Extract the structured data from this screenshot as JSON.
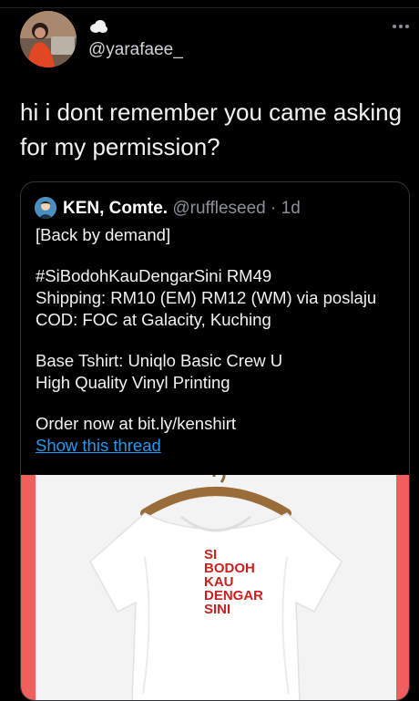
{
  "tweet": {
    "handle": "@yarafaee_",
    "text_line1": "hi i dont remember you came asking",
    "text_line2": "for my permission?"
  },
  "quote": {
    "name": "KEN, Comte.",
    "handle": "@ruffleseed",
    "separator": " · ",
    "time": "1d",
    "lines": [
      "[Back by demand]",
      "",
      "#SiBodohKauDengarSini RM49",
      "Shipping: RM10 (EM) RM12 (WM) via poslaju",
      "COD: FOC at Galacity, Kuching",
      "",
      "Base Tshirt: Uniqlo Basic Crew U",
      "High Quality Vinyl Printing",
      "",
      "Order now at bit.ly/kenshirt"
    ],
    "show_thread": "Show this thread"
  },
  "shirt_print": [
    "SI",
    "BODOH",
    "KAU",
    "DENGAR",
    "SINI"
  ],
  "colors": {
    "background": "#000000",
    "link": "#1d9bf0",
    "media_border": "#f05e5e",
    "print_red": "#c8211e"
  },
  "icons": {
    "more": "more-horizontal-icon",
    "emoji": "cloud-emoji"
  }
}
